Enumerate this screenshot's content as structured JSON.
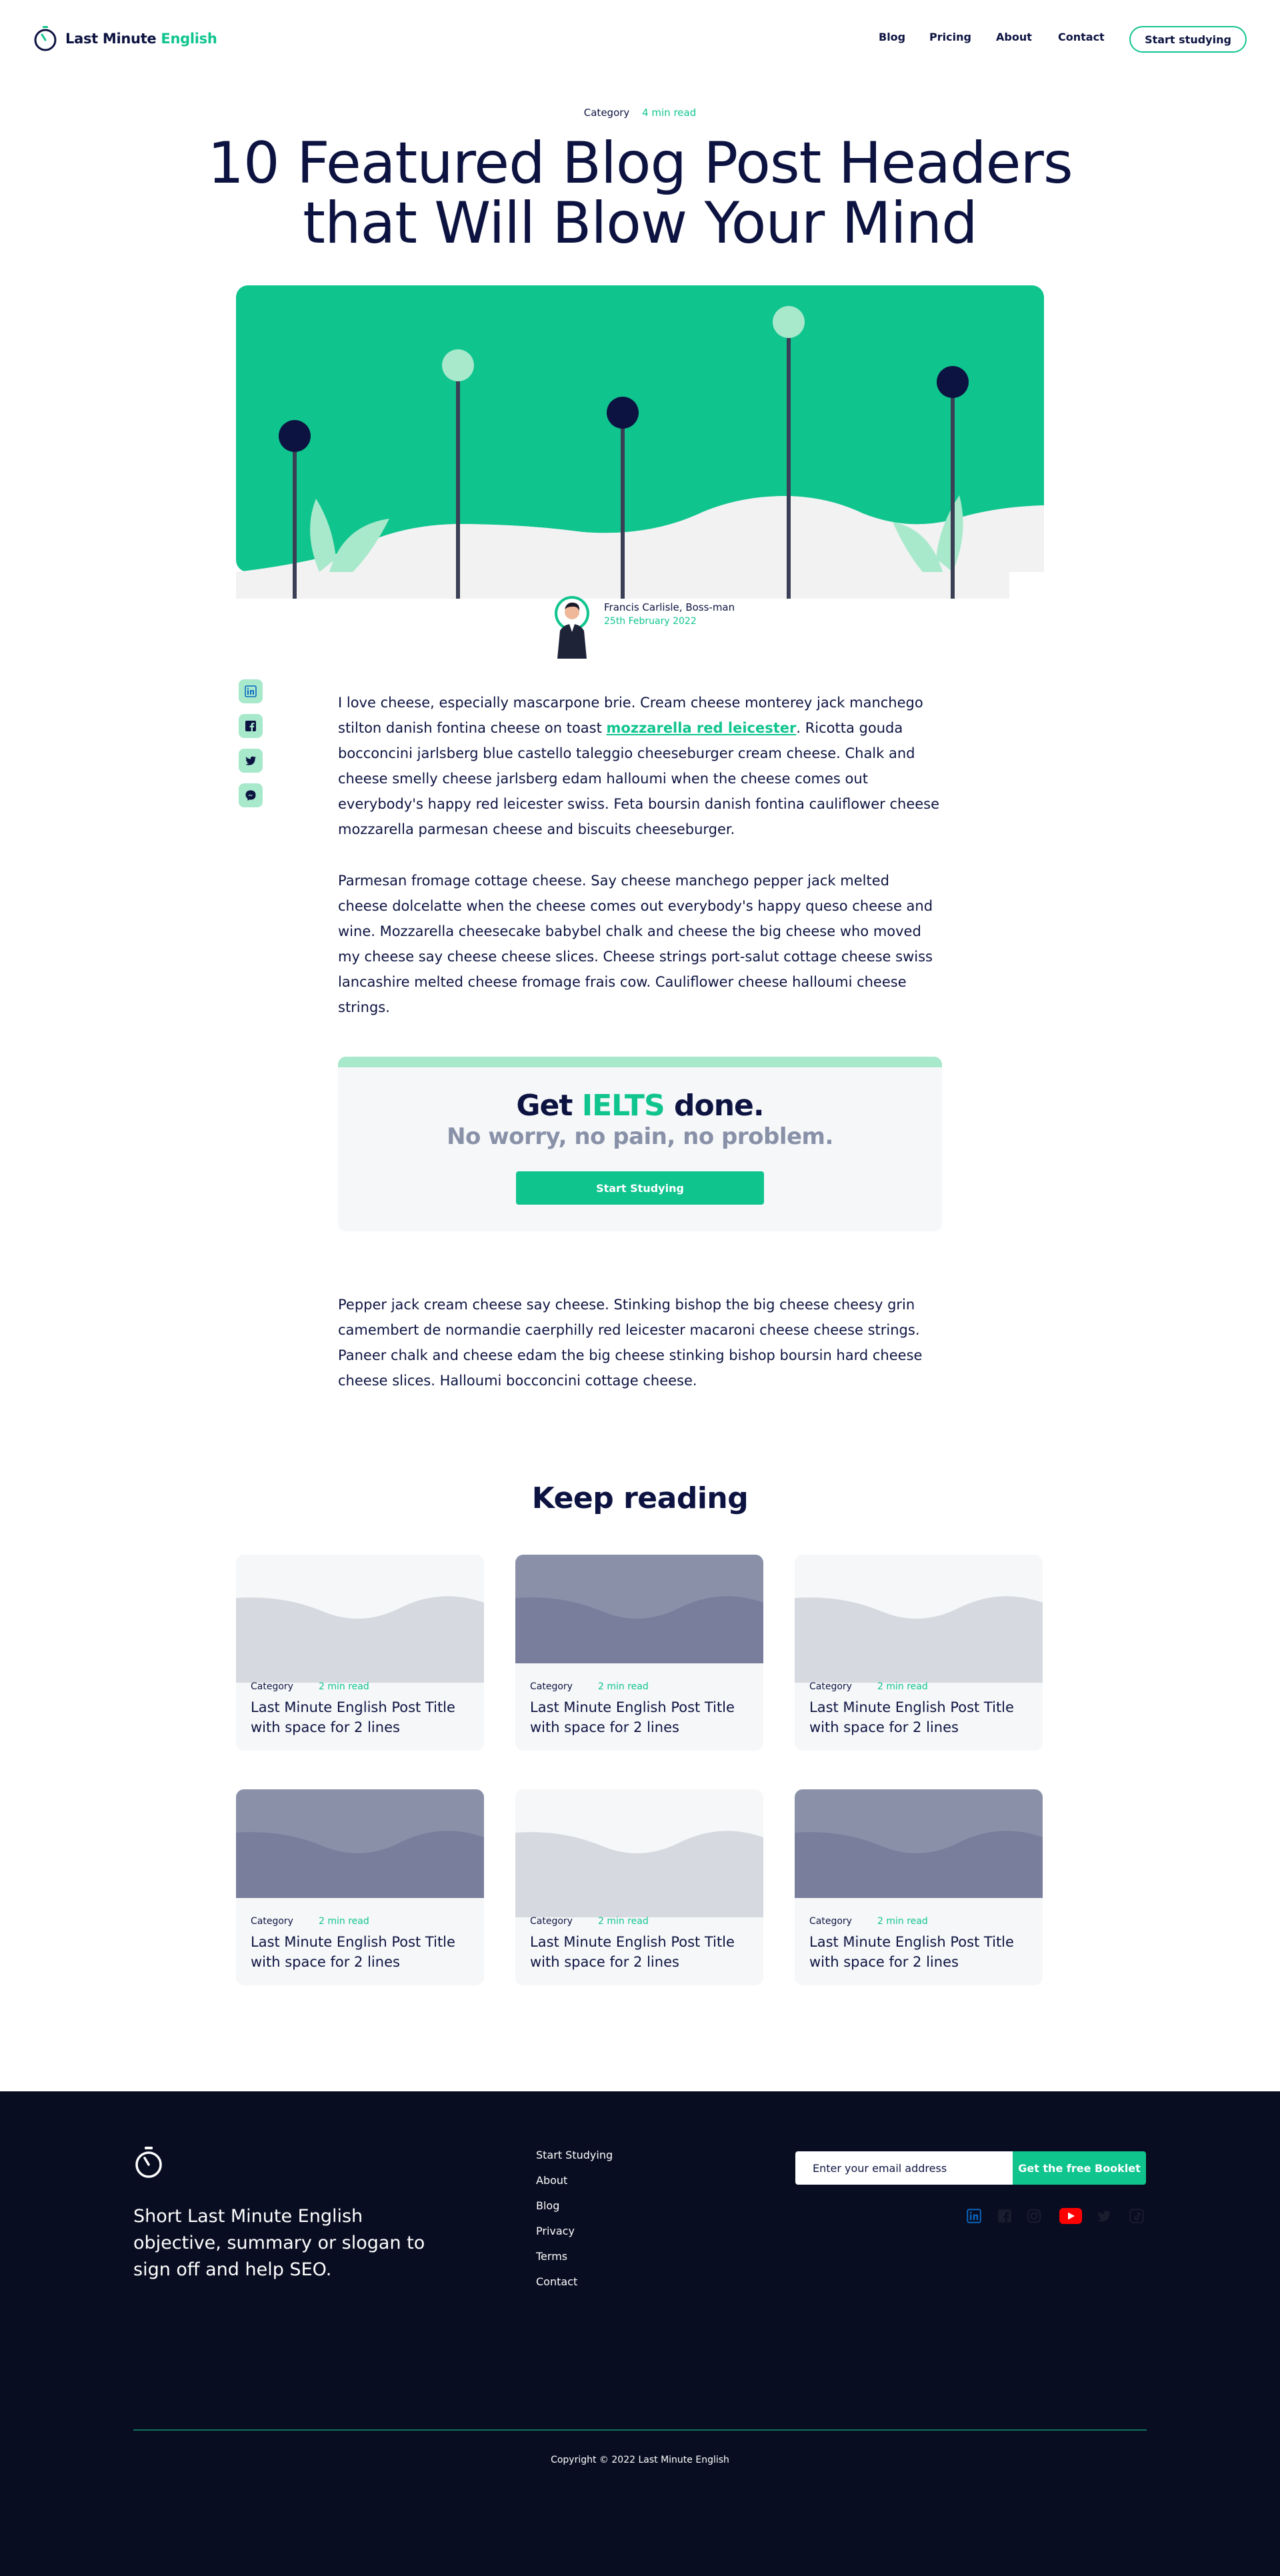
{
  "brand": {
    "name_part1": "Last Minute",
    "name_part2": "English",
    "accent_color": "#10c48e",
    "navy_color": "#0c1340"
  },
  "nav": {
    "links": [
      "Blog",
      "Pricing",
      "About",
      "Contact"
    ],
    "cta": "Start studying"
  },
  "post": {
    "category": "Category",
    "read_time": "4 min read",
    "title_line1": "10 Featured Blog Post Headers",
    "title_line2": "that Will Blow Your Mind",
    "author_name": "Francis Carlisle, Boss-man",
    "author_date": "25th February 2022",
    "share_icons": [
      "linkedin-icon",
      "facebook-icon",
      "twitter-icon",
      "messenger-icon"
    ],
    "p1_before": "I love cheese, especially mascarpone brie. Cream cheese monterey jack manchego stilton danish fontina cheese on toast ",
    "p1_link": "mozzarella red leicester",
    "p1_after": ". Ricotta gouda bocconcini jarlsberg blue castello taleggio cheeseburger cream cheese. Chalk and cheese smelly cheese jarlsberg edam halloumi when the cheese comes out everybody's happy red leicester swiss. Feta boursin danish fontina cauliflower cheese mozzarella parmesan cheese and biscuits cheeseburger.",
    "p2": "Parmesan fromage cottage cheese. Say cheese manchego pepper jack melted cheese dolcelatte when the cheese comes out everybody's happy queso cheese and wine. Mozzarella cheesecake babybel chalk and cheese the big cheese who moved my cheese say cheese cheese slices. Cheese strings port-salut cottage cheese swiss lancashire melted cheese fromage frais cow. Cauliflower cheese halloumi cheese strings.",
    "p3": "Pepper jack cream cheese say cheese. Stinking bishop the big cheese cheesy grin camembert de normandie caerphilly red leicester macaroni cheese cheese strings. Paneer chalk and cheese edam the big cheese stinking bishop boursin hard cheese cheese slices. Halloumi bocconcini cottage cheese."
  },
  "cta": {
    "get": "Get",
    "ielts": "IELTS",
    "done": "done.",
    "subtitle": "No worry, no pain, no problem.",
    "button": "Start Studying"
  },
  "keep_reading": {
    "heading": "Keep reading",
    "cards": [
      {
        "category": "Category",
        "read_time": "2 min read",
        "title": "Last Minute English Post Title with space for 2 lines",
        "theme": "light"
      },
      {
        "category": "Category",
        "read_time": "2 min read",
        "title": "Last Minute English Post Title with space for 2 lines",
        "theme": "dark"
      },
      {
        "category": "Category",
        "read_time": "2 min read",
        "title": "Last Minute English Post Title with space for 2 lines",
        "theme": "light"
      },
      {
        "category": "Category",
        "read_time": "2 min read",
        "title": "Last Minute English Post Title with space for 2 lines",
        "theme": "dark"
      },
      {
        "category": "Category",
        "read_time": "2 min read",
        "title": "Last Minute English Post Title with space for 2 lines",
        "theme": "light"
      },
      {
        "category": "Category",
        "read_time": "2 min read",
        "title": "Last Minute English Post Title with space for 2 lines",
        "theme": "dark"
      }
    ]
  },
  "footer": {
    "tagline": "Short Last Minute English objective, summary or slogan to sign off and help SEO.",
    "links": [
      "Start Studying",
      "About",
      "Blog",
      "Privacy",
      "Terms",
      "Contact"
    ],
    "email_placeholder": "Enter your email address",
    "email_button": "Get the free Booklet",
    "social_icons": [
      "linkedin-icon",
      "facebook-icon",
      "instagram-icon",
      "youtube-icon",
      "twitter-icon",
      "tiktok-icon"
    ],
    "copyright": "Copyright © 2022 Last Minute English"
  }
}
